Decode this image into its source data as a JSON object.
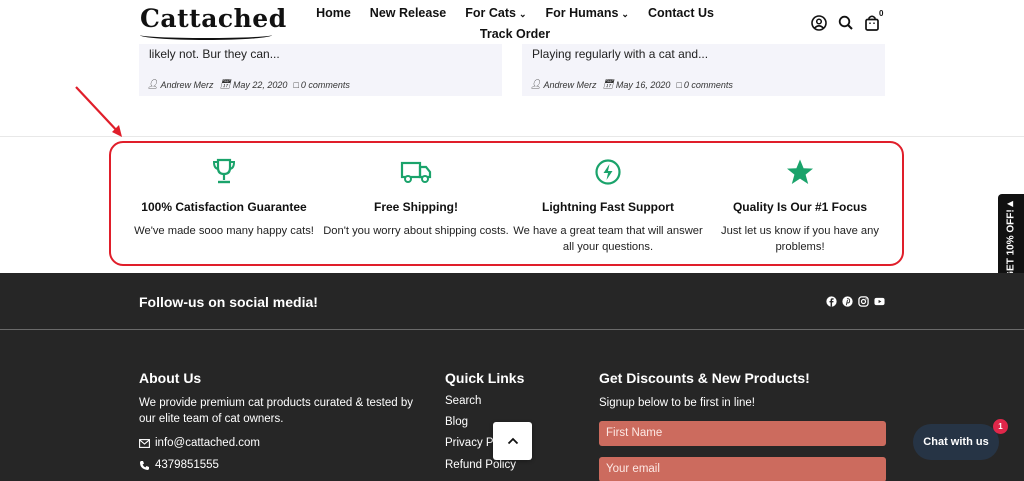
{
  "header": {
    "logo": "Cattached",
    "nav": {
      "home": "Home",
      "new_release": "New Release",
      "for_cats": "For Cats",
      "for_humans": "For Humans",
      "contact_us": "Contact Us",
      "track_order": "Track Order"
    },
    "cart_count": "0"
  },
  "blog": {
    "cards": [
      {
        "excerpt": "likely not. Bur they can...",
        "author": "Andrew Merz",
        "date": "May 22, 2020",
        "comments": "0 comments"
      },
      {
        "excerpt": "Playing regularly with a cat and...",
        "author": "Andrew Merz",
        "date": "May 16, 2020",
        "comments": "0 comments"
      }
    ]
  },
  "features": [
    {
      "icon": "trophy-icon",
      "title": "100% Catisfaction Guarantee",
      "desc": "We've made sooo many happy cats!"
    },
    {
      "icon": "truck-icon",
      "title": "Free Shipping!",
      "desc": "Don't you worry about shipping costs."
    },
    {
      "icon": "lightning-icon",
      "title": "Lightning Fast Support",
      "desc": "We have a great team that will answer all your questions."
    },
    {
      "icon": "star-icon",
      "title": "Quality Is Our #1 Focus",
      "desc": "Just let us know if you have any problems!"
    }
  ],
  "side_tab": {
    "label": "GET 10% OFF!"
  },
  "footer": {
    "follow": "Follow-us on social media!",
    "about": {
      "title": "About Us",
      "text": "We provide premium cat products curated & tested by our elite team of cat owners.",
      "email": "info@cattached.com",
      "phone": "4379851555"
    },
    "quick_links": {
      "title": "Quick Links",
      "links": [
        "Search",
        "Blog",
        "Privacy P",
        "Refund Policy"
      ]
    },
    "discounts": {
      "title": "Get Discounts & New Products!",
      "subtitle": "Signup below to be first in line!",
      "first_name_placeholder": "First Name",
      "email_placeholder": "Your email"
    }
  },
  "chat": {
    "label": "Chat with us",
    "badge": "1"
  },
  "colors": {
    "accent_green": "#1aa36b",
    "highlight_red": "#e01e2a",
    "footer_bg": "#262626",
    "input_bg": "#cc6b5e",
    "chat_bg": "#263445"
  }
}
